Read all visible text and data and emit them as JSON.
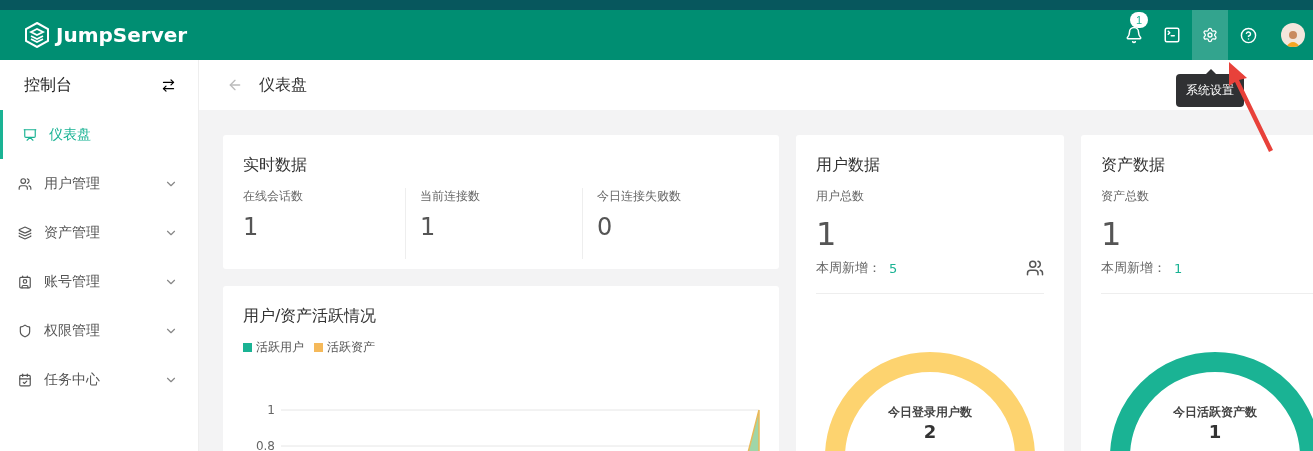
{
  "header": {
    "logo": "JumpServer",
    "notification_count": "1",
    "tools": [
      {
        "kind": "bell",
        "selected": false
      },
      {
        "kind": "terminal",
        "selected": false
      },
      {
        "kind": "settings",
        "selected": true
      },
      {
        "kind": "help",
        "selected": false
      }
    ],
    "tooltip": "系统设置"
  },
  "sidebar": {
    "title": "控制台",
    "items": [
      {
        "label": "仪表盘",
        "kind": "dashboard",
        "selected": true,
        "expandable": false
      },
      {
        "label": "用户管理",
        "kind": "users",
        "selected": false,
        "expandable": true
      },
      {
        "label": "资产管理",
        "kind": "layers",
        "selected": false,
        "expandable": true
      },
      {
        "label": "账号管理",
        "kind": "account",
        "selected": false,
        "expandable": true
      },
      {
        "label": "权限管理",
        "kind": "shield",
        "selected": false,
        "expandable": true
      },
      {
        "label": "任务中心",
        "kind": "calendar",
        "selected": false,
        "expandable": true
      }
    ]
  },
  "breadcrumb": {
    "title": "仪表盘"
  },
  "realtime": {
    "title": "实时数据",
    "stats": [
      {
        "label": "在线会话数",
        "value": "1"
      },
      {
        "label": "当前连接数",
        "value": "1"
      },
      {
        "label": "今日连接失败数",
        "value": "0"
      }
    ]
  },
  "activity": {
    "title": "用户/资产活跃情况",
    "legend": [
      {
        "label": "活跃用户",
        "color": "#1ab394"
      },
      {
        "label": "活跃资产",
        "color": "#f5b95a"
      }
    ],
    "y_tick_labels": [
      "1",
      "0.8"
    ]
  },
  "summaries": [
    {
      "title": "用户数据",
      "total_label": "用户总数",
      "total": "1",
      "weekly_label": "本周新增：",
      "weekly_value": "5",
      "show_icon": true,
      "donut_label": "今日登录用户数",
      "donut_value": "2",
      "color": "#fdd36f"
    },
    {
      "title": "资产数据",
      "total_label": "资产总数",
      "total": "1",
      "weekly_label": "本周新增：",
      "weekly_value": "1",
      "show_icon": false,
      "donut_label": "今日活跃资产数",
      "donut_value": "1",
      "color": "#1ab394"
    }
  ]
}
